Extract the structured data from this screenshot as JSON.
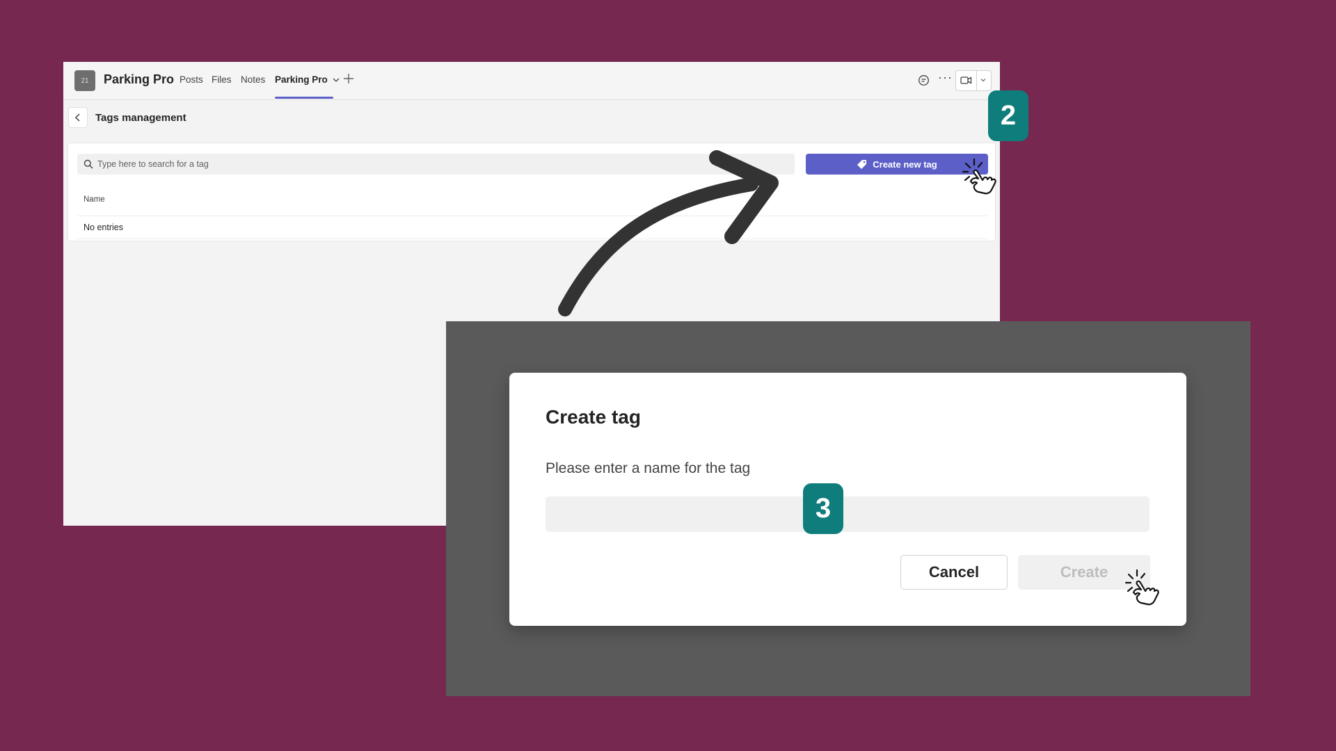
{
  "teams": {
    "team_avatar": "21",
    "team_name": "Parking Pro",
    "tabs": [
      {
        "label": "Posts"
      },
      {
        "label": "Files"
      },
      {
        "label": "Notes"
      },
      {
        "label": "Parking Pro",
        "active": true
      }
    ],
    "page_title": "Tags management",
    "search_placeholder": "Type here to search for a tag",
    "create_button": "Create new tag",
    "table": {
      "columns": [
        "Name"
      ],
      "empty_text": "No entries"
    }
  },
  "badges": {
    "step_2": "2",
    "step_3": "3"
  },
  "dialog": {
    "title": "Create tag",
    "label": "Please enter a name for the tag",
    "input_value": "",
    "cancel_label": "Cancel",
    "create_label": "Create"
  },
  "colors": {
    "background": "#762850",
    "accent": "#5b5fc7",
    "badge": "#0f7d7c",
    "overlay": "#5a5a5a"
  },
  "icons": [
    "chat-icon",
    "more-icon",
    "video-camera-icon",
    "chevron-down-icon",
    "back-chevron-icon",
    "search-icon",
    "tag-icon",
    "plus-icon",
    "pointer-hand-icon",
    "curved-arrow"
  ]
}
